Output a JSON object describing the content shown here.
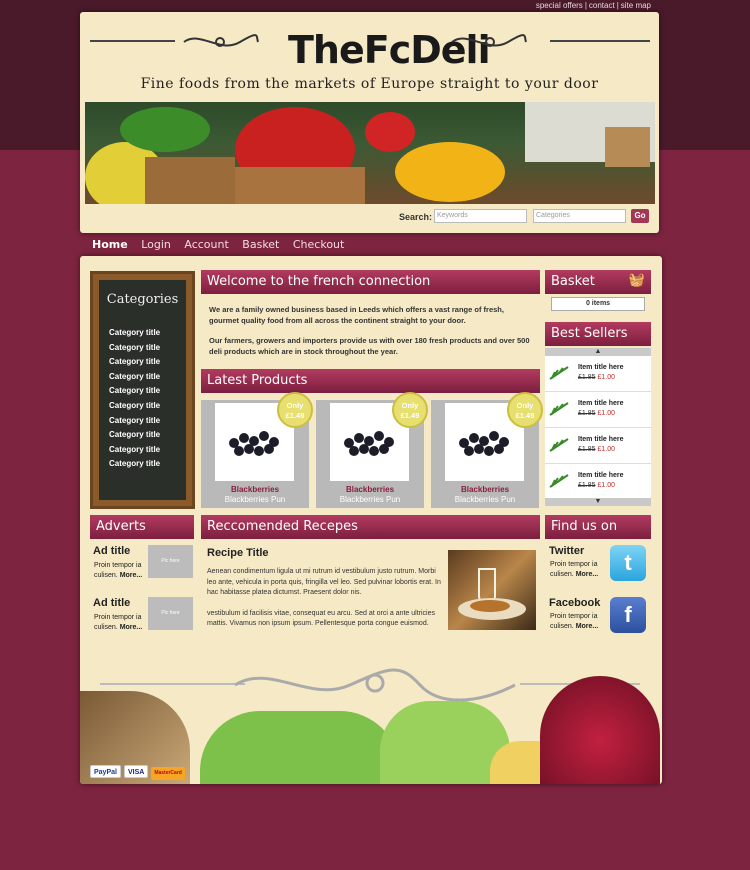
{
  "toplinks": {
    "special_offers": "special offers",
    "sep1": "|",
    "contact": "contact",
    "sep2": "|",
    "site_map": "site map"
  },
  "header": {
    "logo_text": "TheFcDeli",
    "tagline": "Fine foods from the markets of Europe straight to your door"
  },
  "search": {
    "label": "Search:",
    "keywords_placeholder": "Keywords",
    "categories_placeholder": "Categories",
    "go_label": "Go"
  },
  "nav": {
    "items": [
      {
        "label": "Home"
      },
      {
        "label": "Login"
      },
      {
        "label": "Account"
      },
      {
        "label": "Basket"
      },
      {
        "label": "Checkout"
      }
    ]
  },
  "categories": {
    "title": "Categories",
    "items": [
      "Category title",
      "Category title",
      "Category title",
      "Category title",
      "Category title",
      "Category title",
      "Category title",
      "Category title",
      "Category title",
      "Category title"
    ]
  },
  "welcome": {
    "title": "Welcome to the french connection",
    "para1": "We are a family owned business based in Leeds which offers a vast range of fresh, gourmet quality food from all across the continent straight to your door.",
    "para2": "Our farmers, growers and importers provide us with over 180 fresh products and over 500 deli products which are in stock throughout the year."
  },
  "latest": {
    "title": "Latest Products",
    "products": [
      {
        "badge_top": "Only",
        "badge_price": "£1.49",
        "name": "Blackberries",
        "desc": "Blackberries Pun"
      },
      {
        "badge_top": "Only",
        "badge_price": "£1.49",
        "name": "Blackberries",
        "desc": "Blackberries Pun"
      },
      {
        "badge_top": "Only",
        "badge_price": "£1.49",
        "name": "Blackberries",
        "desc": "Blackberries Pun"
      }
    ]
  },
  "basket": {
    "title": "Basket",
    "items": "0 items"
  },
  "best_sellers": {
    "title": "Best Sellers",
    "items": [
      {
        "title": "Item title here",
        "old_price": "£1.85",
        "new_price": "£1.00"
      },
      {
        "title": "Item title here",
        "old_price": "£1.85",
        "new_price": "£1.00"
      },
      {
        "title": "Item title here",
        "old_price": "£1.85",
        "new_price": "£1.00"
      },
      {
        "title": "Item title here",
        "old_price": "£1.85",
        "new_price": "£1.00"
      }
    ]
  },
  "adverts": {
    "title": "Adverts",
    "items": [
      {
        "title": "Ad title",
        "body": "Proin tempor ia culisen.",
        "more": "More...",
        "pic": "Pic here"
      },
      {
        "title": "Ad title",
        "body": "Proin tempor ia culisen.",
        "more": "More...",
        "pic": "Pic here"
      }
    ]
  },
  "recipes": {
    "title": "Reccomended Recepes",
    "recipe_title": "Recipe Title",
    "para1": "Aenean condimentum ligula ut mi rutrum id vestibulum justo rutrum. Morbi leo ante, vehicula in porta quis, fringilla vel leo. Sed pulvinar lobortis erat. In hac habitasse platea dictumst. Praesent dolor nis.",
    "para2": "vestibulum id facilisis vitae, consequat eu arcu. Sed at orci a ante ultricies mattis. Vivamus non ipsum ipsum. Pellentesque porta congue euismod."
  },
  "find_us": {
    "title": "Find us on",
    "items": [
      {
        "title": "Twitter",
        "body": "Proin tempor ia culisen.",
        "more": "More...",
        "icon_glyph": "t"
      },
      {
        "title": "Facebook",
        "body": "Proin tempor ia culisen.",
        "more": "More...",
        "icon_glyph": "f"
      }
    ]
  },
  "payment": {
    "paypal": "PayPal",
    "visa": "VISA",
    "mastercard": "MasterCard"
  },
  "colors": {
    "brand": "#7d2440",
    "panel": "#f6e9c6",
    "accent_price": "#c62c2c"
  }
}
